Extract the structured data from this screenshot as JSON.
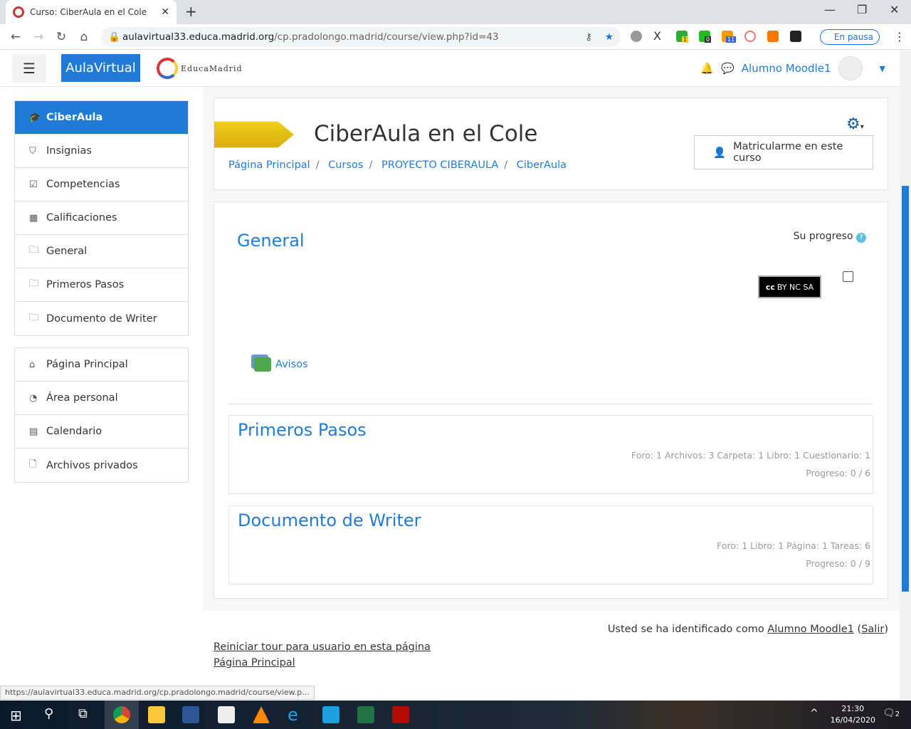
{
  "browser": {
    "tab_title": "Curso: CiberAula en el Cole",
    "url_host": "aulavirtual33.educa.madrid.org",
    "url_path": "/cp.pradolongo.madrid/course/view.php?id=43",
    "profile_status": "En pausa",
    "status_url": "https://aulavirtual33.educa.madrid.org/cp.pradolongo.madrid/course/view.p...",
    "ext_badges": [
      "1",
      "0",
      "11"
    ]
  },
  "topnav": {
    "brand": "AulaVirtual",
    "logo_text": "EducaMadrid",
    "user": "Alumno Moodle1"
  },
  "sidebar": {
    "course": [
      {
        "icon": "graduation-cap",
        "label": "CiberAula"
      },
      {
        "icon": "shield",
        "label": "Insignias"
      },
      {
        "icon": "check-square",
        "label": "Competencias"
      },
      {
        "icon": "table",
        "label": "Calificaciones"
      },
      {
        "icon": "folder",
        "label": "General"
      },
      {
        "icon": "folder",
        "label": "Primeros Pasos"
      },
      {
        "icon": "folder",
        "label": "Documento de Writer"
      }
    ],
    "site": [
      {
        "icon": "home",
        "label": "Página Principal"
      },
      {
        "icon": "dashboard",
        "label": "Área personal"
      },
      {
        "icon": "calendar",
        "label": "Calendario"
      },
      {
        "icon": "file",
        "label": "Archivos privados"
      }
    ]
  },
  "header": {
    "title": "CiberAula en el Cole",
    "breadcrumbs": [
      "Página Principal",
      "Cursos",
      "PROYECTO CIBERAULA",
      "CiberAula"
    ],
    "menu_item": "Matricularme en este curso"
  },
  "main": {
    "general_title": "General",
    "progress_label": "Su progreso",
    "license": "BY NC SA",
    "avisos": "Avisos",
    "sections": [
      {
        "title": "Primeros Pasos",
        "stats": "Foro: 1  Archivos: 3  Carpeta: 1  Libro: 1  Cuestionario: 1",
        "progress": "Progreso: 0 / 6"
      },
      {
        "title": "Documento de Writer",
        "stats": "Foro: 1  Libro: 1  Página: 1  Tareas: 6",
        "progress": "Progreso: 0 / 9"
      }
    ]
  },
  "footer": {
    "logged_prefix": "Usted se ha identificado como ",
    "user": "Alumno Moodle1",
    "logout": "Salir",
    "tour": "Reiniciar tour para usuario en esta página",
    "home": "Página Principal"
  },
  "taskbar": {
    "time": "21:30",
    "date": "16/04/2020",
    "notifications": "2"
  }
}
